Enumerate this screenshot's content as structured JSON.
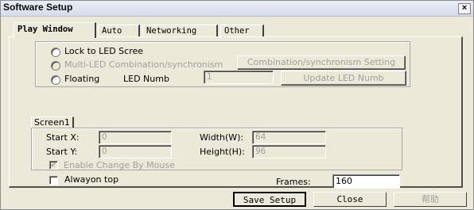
{
  "window": {
    "title": "Software Setup",
    "close_glyph": "×"
  },
  "tabs": [
    {
      "label": "Play Window",
      "active": true
    },
    {
      "label": "Auto",
      "active": false
    },
    {
      "label": "Networking",
      "active": false
    },
    {
      "label": "Other",
      "active": false
    }
  ],
  "mode": {
    "lock_label": "Lock to LED Scree",
    "multi_label": "Multi-LED Combination/synchronism",
    "combination_button": "Combination/synchronism Setting",
    "floating_label": "Floating",
    "led_numb_label": "LED Numb",
    "led_numb_value": "1",
    "update_button": "Update LED Numb"
  },
  "screen": {
    "tab_label": "Screen1",
    "start_x_label": "Start X:",
    "start_x_value": "0",
    "start_y_label": "Start Y:",
    "start_y_value": "0",
    "width_label": "Width(W):",
    "width_value": "64",
    "height_label": "Height(H):",
    "height_value": "96",
    "enable_mouse_label": "Enable Change By Mouse",
    "enable_mouse_checked": true
  },
  "always_on_top_label": "Alwayon top",
  "always_on_top_checked": false,
  "frames_label": "Frames:",
  "frames_value": "160",
  "buttons": {
    "save": "Save Setup",
    "close": "Close",
    "help": "帮助"
  }
}
